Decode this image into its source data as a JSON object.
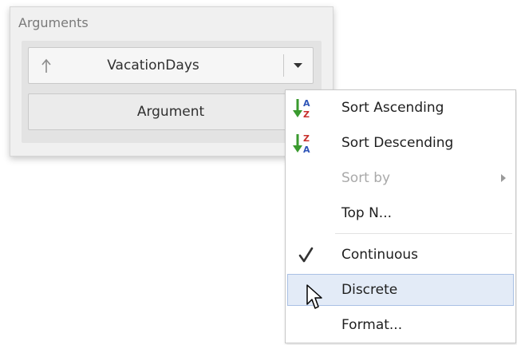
{
  "panel": {
    "title": "Arguments",
    "fields": [
      {
        "label": "VacationDays",
        "sort_indicator": "arrow-up-icon",
        "has_dropdown": true
      },
      {
        "label": "Argument"
      }
    ]
  },
  "context_menu": {
    "items": [
      {
        "label": "Sort Ascending",
        "icon": "sort-ascending-icon",
        "enabled": true
      },
      {
        "label": "Sort Descending",
        "icon": "sort-descending-icon",
        "enabled": true
      },
      {
        "label": "Sort by",
        "icon": null,
        "enabled": false,
        "has_submenu": true
      },
      {
        "label": "Top N...",
        "icon": null,
        "enabled": true
      },
      {
        "label": "Continuous",
        "icon": "checkmark-icon",
        "enabled": true,
        "checked": true
      },
      {
        "label": "Discrete",
        "icon": null,
        "enabled": true,
        "highlighted": true
      },
      {
        "label": "Format...",
        "icon": null,
        "enabled": true
      }
    ]
  },
  "colors": {
    "highlight_bg": "#e3ebf7",
    "highlight_border": "#a9c0e4",
    "arrow_green": "#3a9a2e",
    "letter_blue": "#2f55b8",
    "letter_red": "#c8302c"
  }
}
